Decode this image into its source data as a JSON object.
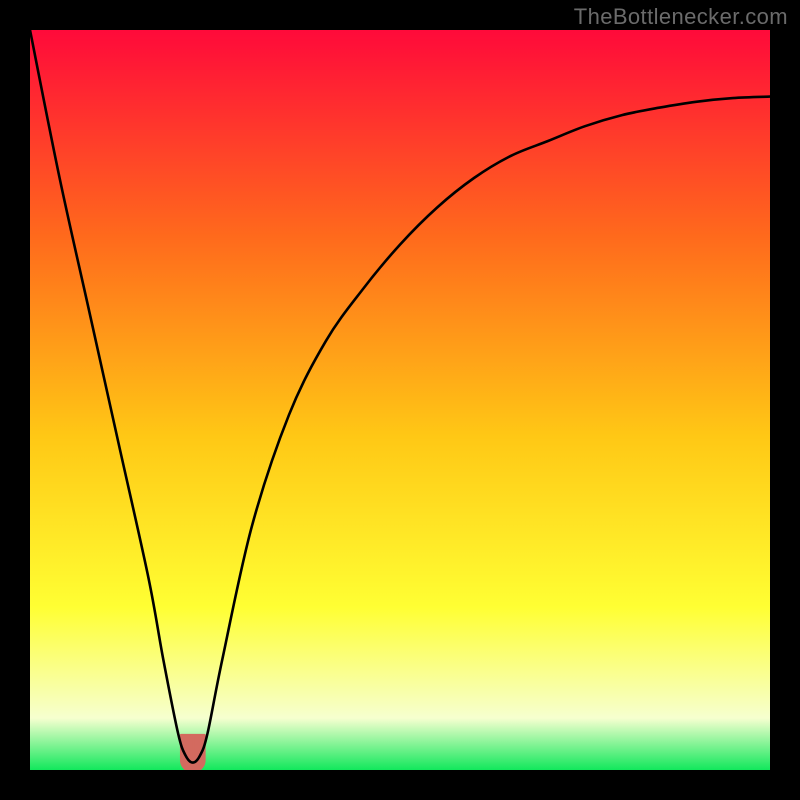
{
  "watermark": "TheBottlenecker.com",
  "gradient": {
    "top": "#ff0a3a",
    "upper_mid": "#ff6a1c",
    "mid": "#ffc815",
    "lower_mid": "#ffff33",
    "pale": "#f6ffcf",
    "bottom": "#12e85c"
  },
  "chart_data": {
    "type": "line",
    "title": "",
    "xlabel": "",
    "ylabel": "",
    "xlim": [
      0,
      100
    ],
    "ylim": [
      0,
      100
    ],
    "series": [
      {
        "name": "bottleneck-curve",
        "x": [
          0,
          4,
          8,
          12,
          16,
          18,
          20,
          21,
          22,
          23,
          24,
          26,
          30,
          35,
          40,
          45,
          50,
          55,
          60,
          65,
          70,
          75,
          80,
          85,
          90,
          95,
          100
        ],
        "y": [
          100,
          80,
          62,
          44,
          26,
          15,
          5,
          2,
          1,
          2,
          5,
          15,
          33,
          48,
          58,
          65,
          71,
          76,
          80,
          83,
          85,
          87,
          88.5,
          89.5,
          90.3,
          90.8,
          91
        ]
      }
    ],
    "marker": {
      "name": "bottleneck-minimum",
      "x": 22,
      "y_center": 2.5,
      "color": "#d36a5f",
      "shape": "u",
      "width_pct": 3.2,
      "height_pct": 5
    },
    "legend": null,
    "grid": false
  }
}
